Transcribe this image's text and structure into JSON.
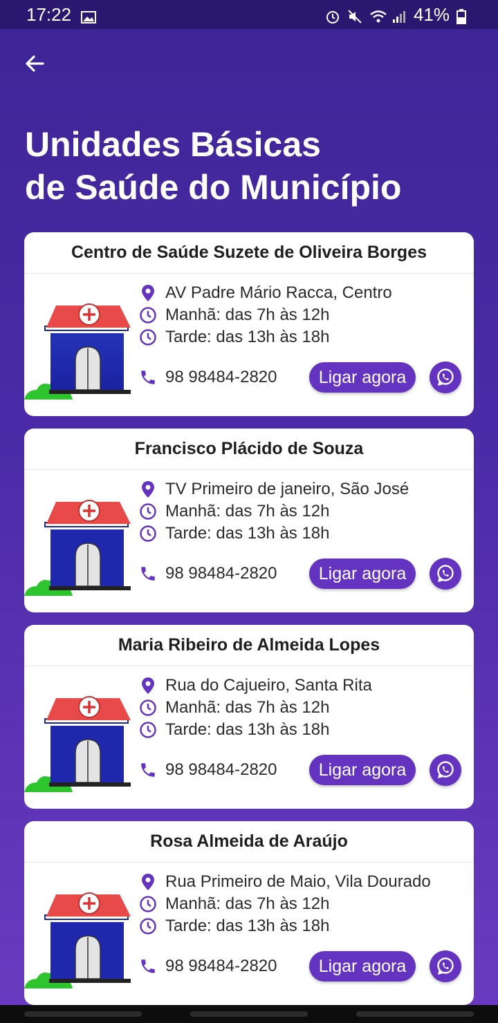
{
  "status_bar": {
    "time": "17:22",
    "battery": "41%",
    "icons": [
      "image-icon",
      "alarm-icon",
      "mute-icon",
      "wifi-icon",
      "signal-icon",
      "battery-icon"
    ]
  },
  "header": {
    "back_icon": "arrow-left-icon",
    "title_line1": "Unidades Básicas",
    "title_line2": "de Saúde do Município"
  },
  "colors": {
    "accent": "#6434c0",
    "background_top": "#3d2596",
    "background_bottom": "#6a3bc0"
  },
  "units": [
    {
      "name": "Centro de Saúde Suzete de Oliveira Borges",
      "address": "AV Padre Mário Racca, Centro",
      "morning": "Manhã: das 7h às 12h",
      "afternoon": "Tarde: das 13h às 18h",
      "phone": "98 98484-2820",
      "call_label": "Ligar agora"
    },
    {
      "name": "Francisco Plácido de Souza",
      "address": "TV Primeiro de janeiro, São José",
      "morning": "Manhã: das 7h às 12h",
      "afternoon": "Tarde: das 13h às 18h",
      "phone": "98 98484-2820",
      "call_label": "Ligar agora"
    },
    {
      "name": "Maria Ribeiro de Almeida Lopes",
      "address": "Rua do Cajueiro, Santa Rita",
      "morning": "Manhã: das 7h às 12h",
      "afternoon": "Tarde: das 13h às 18h",
      "phone": "98 98484-2820",
      "call_label": "Ligar agora"
    },
    {
      "name": "Rosa Almeida de Araújo",
      "address": "Rua Primeiro de Maio, Vila Dourado",
      "morning": "Manhã: das 7h às 12h",
      "afternoon": "Tarde: das 13h às 18h",
      "phone": "98 98484-2820",
      "call_label": "Ligar agora"
    }
  ]
}
